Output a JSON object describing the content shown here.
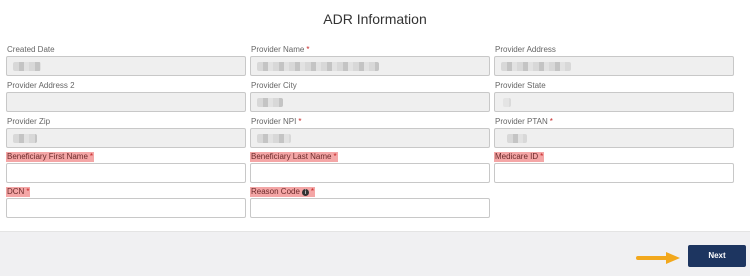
{
  "page": {
    "title": "ADR Information",
    "next_label": "Next"
  },
  "fields": {
    "created_date": {
      "label": "Created Date"
    },
    "provider_name": {
      "label": "Provider Name",
      "required": "*"
    },
    "provider_address": {
      "label": "Provider Address"
    },
    "provider_address_2": {
      "label": "Provider Address 2"
    },
    "provider_city": {
      "label": "Provider City"
    },
    "provider_state": {
      "label": "Provider State"
    },
    "provider_zip": {
      "label": "Provider Zip"
    },
    "provider_npi": {
      "label": "Provider NPI",
      "required": "*"
    },
    "provider_ptan": {
      "label": "Provider PTAN",
      "required": "*"
    },
    "beneficiary_first_name": {
      "label": "Beneficiary First Name",
      "required": "*"
    },
    "beneficiary_last_name": {
      "label": "Beneficiary Last Name",
      "required": "*"
    },
    "medicare_id": {
      "label": "Medicare ID",
      "required": "*"
    },
    "dcn": {
      "label": "DCN",
      "required": "*"
    },
    "reason_code": {
      "label": "Reason Code",
      "required": "*"
    }
  },
  "icons": {
    "info": "info-icon",
    "arrow": "arrow-right-icon"
  },
  "colors": {
    "highlight": "#f4a6a6",
    "required": "#c62828",
    "button": "#1d3560",
    "arrow": "#f2a81d"
  }
}
